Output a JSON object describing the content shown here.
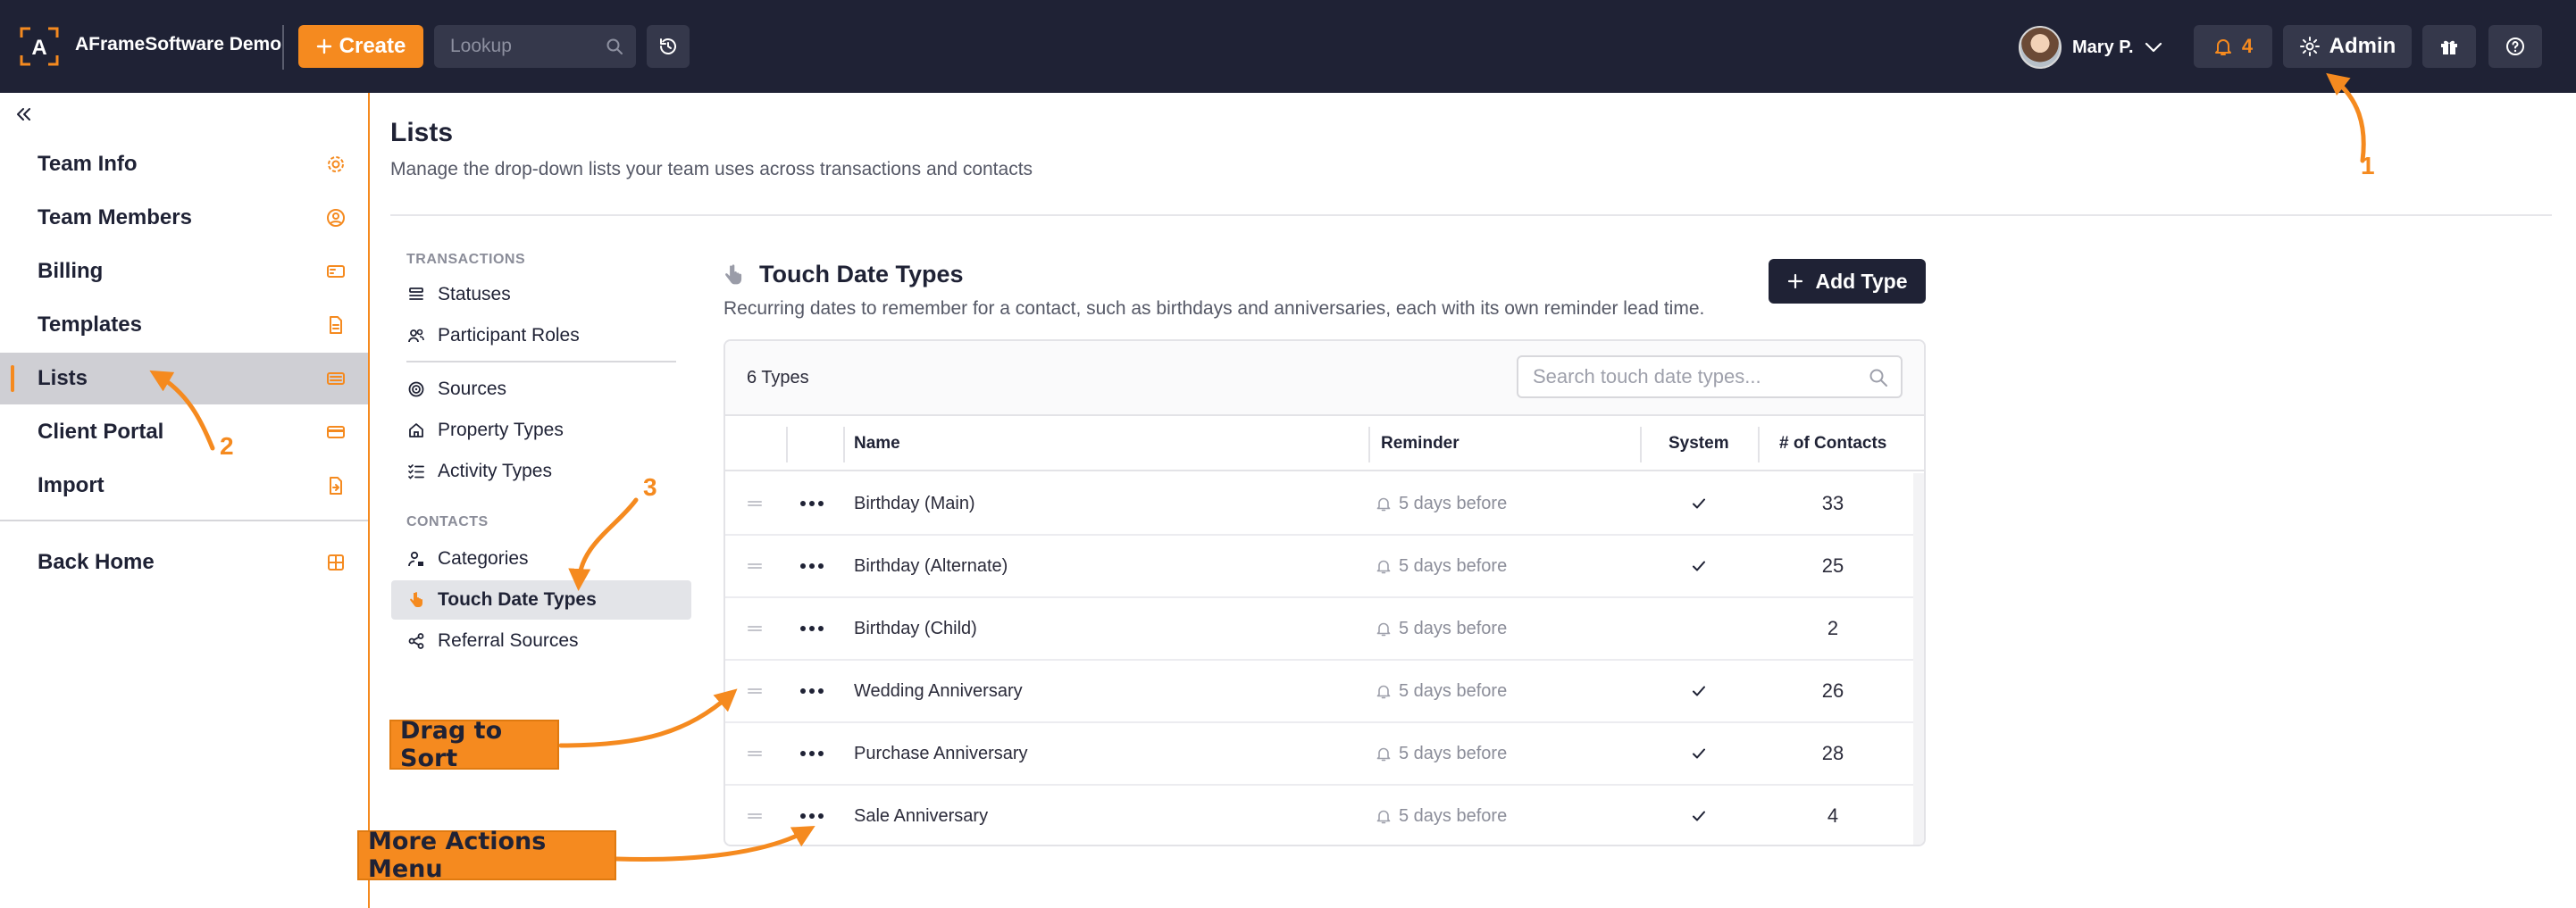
{
  "topbar": {
    "brand": "AFrameSoftware Demo",
    "create_label": "Create",
    "lookup_placeholder": "Lookup",
    "user_name": "Mary P.",
    "notification_count": "4",
    "admin_label": "Admin"
  },
  "sidebar": {
    "items": [
      {
        "label": "Team Info",
        "icon": "gear-icon"
      },
      {
        "label": "Team Members",
        "icon": "user-circle-icon"
      },
      {
        "label": "Billing",
        "icon": "billing-card-icon"
      },
      {
        "label": "Templates",
        "icon": "document-icon"
      },
      {
        "label": "Lists",
        "icon": "list-card-icon",
        "active": true
      },
      {
        "label": "Client Portal",
        "icon": "credit-card-icon"
      },
      {
        "label": "Import",
        "icon": "import-icon"
      }
    ],
    "back_home": {
      "label": "Back Home",
      "icon": "grid-icon"
    }
  },
  "page": {
    "title": "Lists",
    "subtitle": "Manage the drop-down lists your team uses across transactions and contacts"
  },
  "subnav": {
    "transactions_heading": "TRANSACTIONS",
    "transactions": [
      {
        "label": "Statuses",
        "icon": "stack-icon"
      },
      {
        "label": "Participant Roles",
        "icon": "people-icon"
      },
      {
        "label": "Sources",
        "icon": "target-icon"
      },
      {
        "label": "Property Types",
        "icon": "home-icon"
      },
      {
        "label": "Activity Types",
        "icon": "checklist-icon"
      }
    ],
    "contacts_heading": "CONTACTS",
    "contacts": [
      {
        "label": "Categories",
        "icon": "user-tag-icon"
      },
      {
        "label": "Touch Date Types",
        "icon": "hand-pointer-icon",
        "active": true
      },
      {
        "label": "Referral Sources",
        "icon": "share-icon"
      }
    ]
  },
  "section": {
    "title": "Touch Date Types",
    "description": "Recurring dates to remember for a contact, such as birthdays and anniversaries, each with its own reminder lead time.",
    "add_button": "Add Type"
  },
  "table": {
    "count_label": "6 Types",
    "search_placeholder": "Search touch date types...",
    "columns": {
      "name": "Name",
      "reminder": "Reminder",
      "system": "System",
      "contacts": "# of Contacts"
    },
    "rows": [
      {
        "name": "Birthday (Main)",
        "reminder": "5 days before",
        "system": true,
        "contacts": "33"
      },
      {
        "name": "Birthday (Alternate)",
        "reminder": "5 days before",
        "system": true,
        "contacts": "25"
      },
      {
        "name": "Birthday (Child)",
        "reminder": "5 days before",
        "system": false,
        "contacts": "2"
      },
      {
        "name": "Wedding Anniversary",
        "reminder": "5 days before",
        "system": true,
        "contacts": "26"
      },
      {
        "name": "Purchase Anniversary",
        "reminder": "5 days before",
        "system": true,
        "contacts": "28"
      },
      {
        "name": "Sale Anniversary",
        "reminder": "5 days before",
        "system": true,
        "contacts": "4"
      }
    ]
  },
  "annotations": {
    "num1": "1",
    "num2": "2",
    "num3": "3",
    "drag_to_sort": "Drag to Sort",
    "more_actions": "More Actions Menu"
  },
  "colors": {
    "accent": "#f58a1f",
    "topbar": "#1f2235",
    "active_row": "#cfcfd4"
  }
}
